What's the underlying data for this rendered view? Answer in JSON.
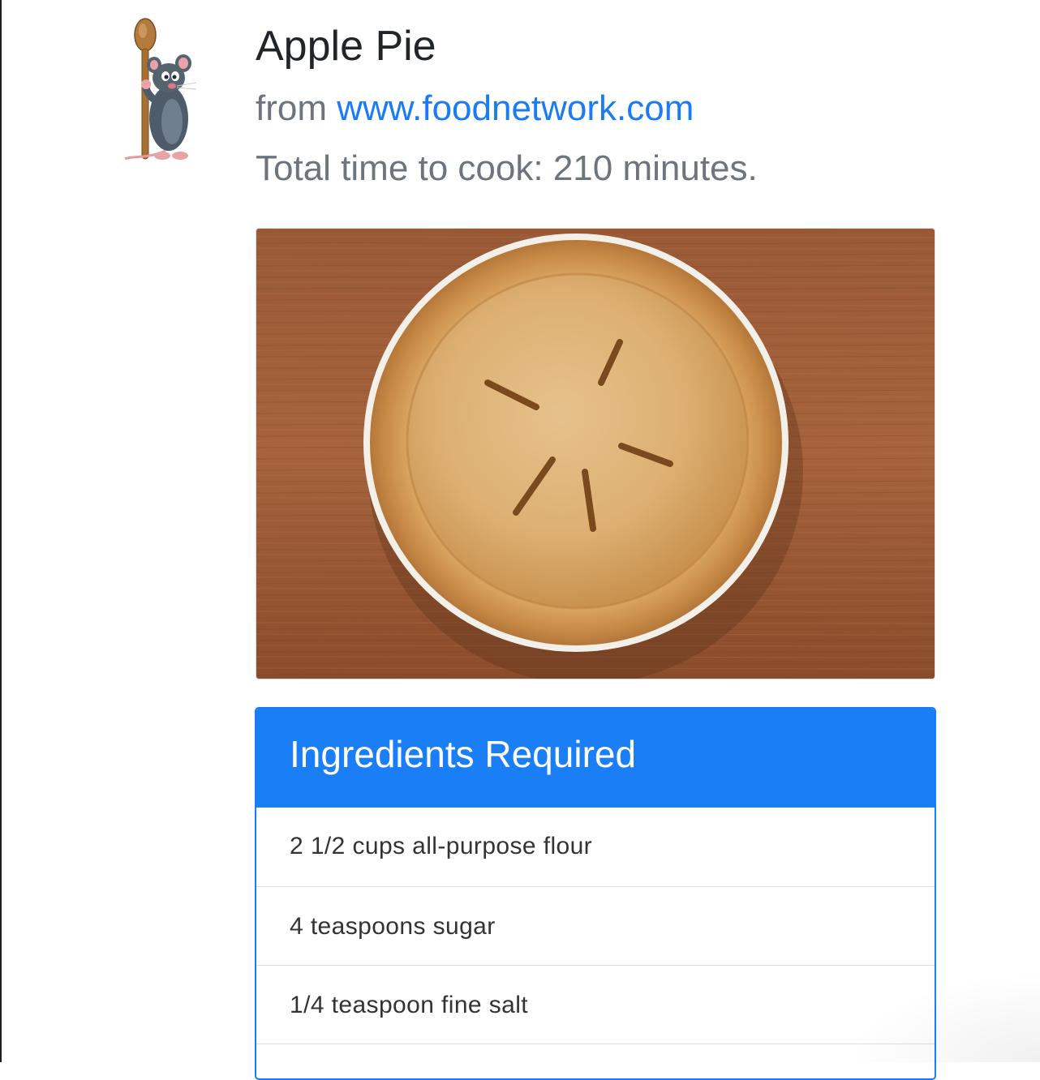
{
  "recipe": {
    "title": "Apple Pie",
    "source_prefix": "from ",
    "source_link": "www.foodnetwork.com",
    "total_time": "Total time to cook: 210 minutes."
  },
  "ingredients": {
    "header": "Ingredients Required",
    "items": [
      "2 1/2 cups all-purpose flour",
      "4 teaspoons sugar",
      "1/4 teaspoon fine salt",
      ""
    ]
  },
  "images": {
    "mascot": "chef-rat-with-wooden-spoon",
    "photo": "apple-pie-on-wooden-table"
  },
  "colors": {
    "link": "#1a7cf5",
    "card_header": "#1a7ff7",
    "muted_text": "#6c757d"
  }
}
